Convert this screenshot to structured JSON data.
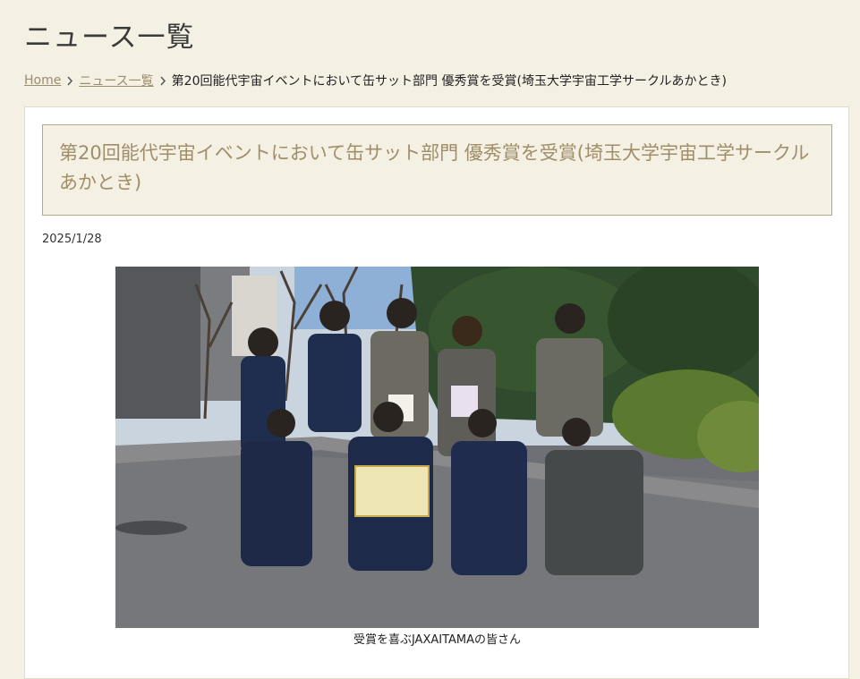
{
  "page": {
    "heading": "ニュース一覧"
  },
  "breadcrumb": {
    "items": [
      {
        "label": "Home",
        "link": true
      },
      {
        "label": "ニュース一覧",
        "link": true
      },
      {
        "label": "第20回能代宇宙イベントにおいて缶サット部門 優秀賞を受賞(埼玉大学宇宙工学サークルあかとき)",
        "link": false
      }
    ],
    "separator_icon": "chevron-right-icon"
  },
  "article": {
    "title": "第20回能代宇宙イベントにおいて缶サット部門 優秀賞を受賞(埼玉大学宇宙工学サークルあかとき)",
    "date": "2025/1/28",
    "photo": {
      "icon": "group-photo",
      "caption": "受賞を喜ぶJAXAITAMAの皆さん"
    }
  },
  "colors": {
    "background": "#f5f0e4",
    "card": "#ffffff",
    "title_text": "#a08e68",
    "title_border": "#b5a887",
    "link": "#9a8c6c"
  }
}
